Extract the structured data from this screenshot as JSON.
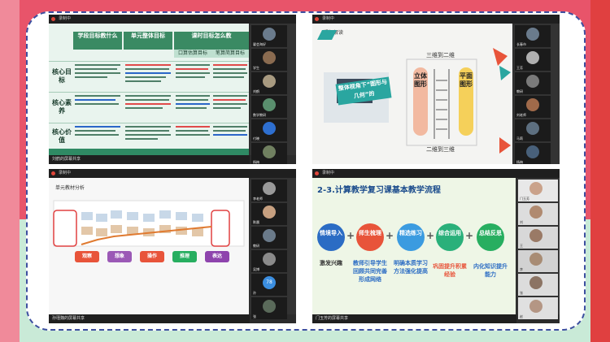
{
  "panel1": {
    "recording": "录制中",
    "share_label": "刘鹤的屏幕共享",
    "headers": [
      "学段目标教什么",
      "单元整体目标",
      "课时目标怎么教"
    ],
    "header_red": "教什么",
    "subheaders": [
      "口算估算目标",
      "笔算简算目标"
    ],
    "rows": [
      "核心目标",
      "核心素养",
      "核心价值"
    ],
    "participants": [
      "翟会海好",
      "学生",
      "刘鹤",
      "数学教研",
      "付晓",
      "杨梅",
      "王淑敏"
    ]
  },
  "panel2": {
    "recording": "录制中",
    "title": "课标解读",
    "banner": "整体视角下“图形与几何”的",
    "left_vertical": "立体图形",
    "right_vertical": "平面图形",
    "top_label": "三维到二维",
    "bottom_label": "二维到三维",
    "participants": [
      "长春市",
      "王芳",
      "教研",
      "刘老师",
      "马莉",
      "杨梅",
      "王丽"
    ]
  },
  "panel3": {
    "recording": "录制中",
    "title": "单元教材分析",
    "share_label": "孙瑾魏的屏幕共享",
    "steps": [
      "观察",
      "想象",
      "操作",
      "推理",
      "表达"
    ],
    "step_colors": [
      "#e8543a",
      "#9b59b6",
      "#e8543a",
      "#27ae60",
      "#8e44ad"
    ],
    "participants": [
      "李老师",
      "陈晨",
      "教研",
      "吴博",
      "孙",
      "张",
      "孙瑾魏"
    ],
    "count_badge": "78"
  },
  "panel4": {
    "recording": "录制中",
    "title": "2-3.计算教学复习课基本教学流程",
    "share_label": "门玉芳的屏幕共享",
    "circles": [
      "情境导入",
      "师生梳理",
      "精选练习",
      "综合运用",
      "总结反思"
    ],
    "circle_colors": [
      "#2b6cc4",
      "#e8543a",
      "#3b9be0",
      "#2ab07a",
      "#27ae60"
    ],
    "texts": [
      "激发兴趣",
      "教师引导学生回顾共同完善形成网络",
      "明确本质学习方法强化提高",
      "巩固提升积累经验",
      "内化知识提升能力"
    ],
    "participants": [
      "门玉芳",
      "刘",
      "王",
      "李",
      "张",
      "赵"
    ]
  }
}
